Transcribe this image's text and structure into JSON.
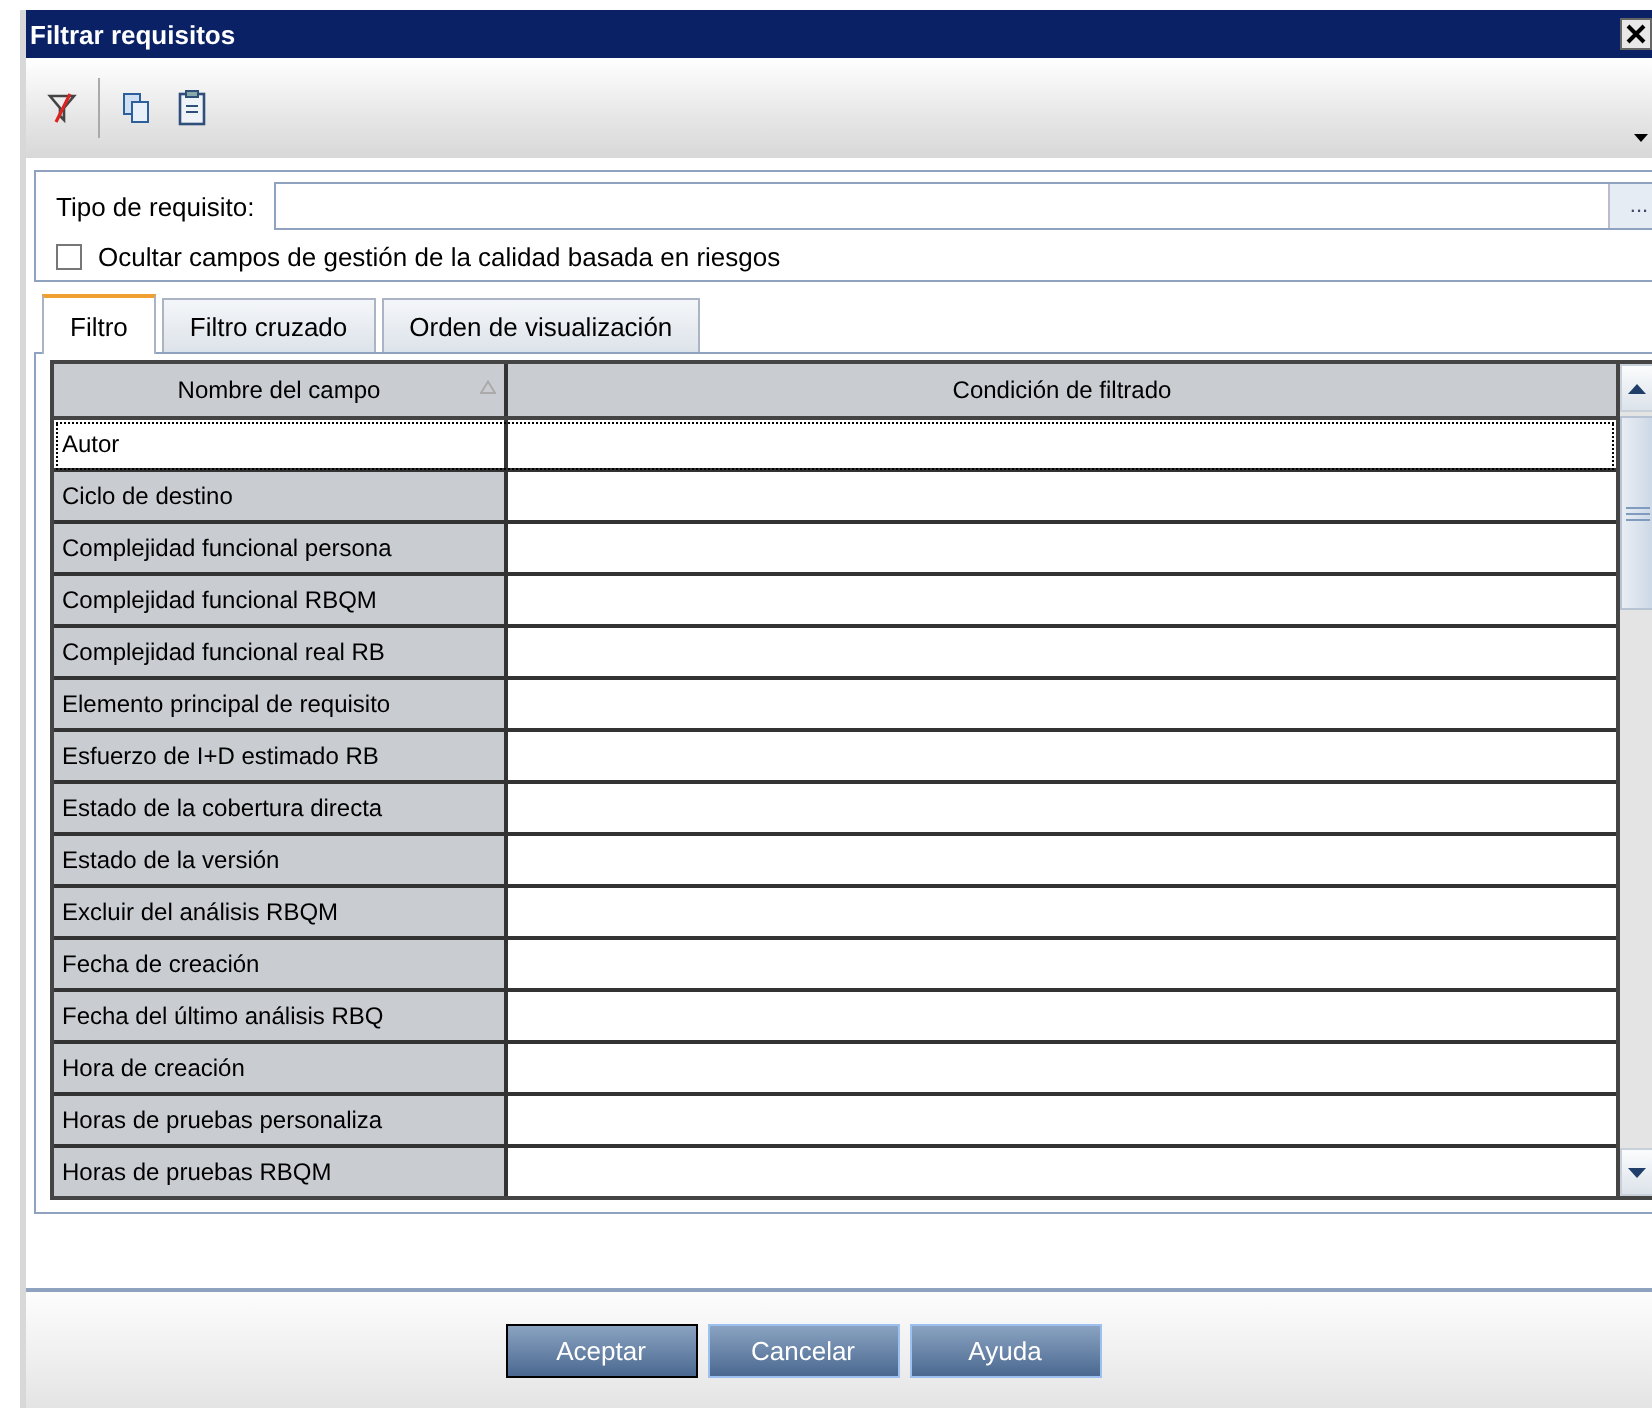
{
  "window": {
    "title": "Filtrar requisitos"
  },
  "toolbar": {
    "has_menu": true
  },
  "type_field": {
    "label": "Tipo de requisito:",
    "browse": "..."
  },
  "hide_option": {
    "label": "Ocultar campos de gestión de la calidad basada en riesgos",
    "checked": false
  },
  "tabs": [
    {
      "label": "Filtro",
      "selected": true
    },
    {
      "label": "Filtro cruzado",
      "selected": false
    },
    {
      "label": "Orden de visualización",
      "selected": false
    }
  ],
  "table": {
    "columns": [
      {
        "label": "Nombre del campo",
        "sorted": true
      },
      {
        "label": "Condición de filtrado",
        "sorted": false
      }
    ],
    "rows": [
      {
        "field": "Autor",
        "selected": true
      },
      {
        "field": "Ciclo de destino",
        "selected": false
      },
      {
        "field": "Complejidad funcional persona",
        "selected": false
      },
      {
        "field": "Complejidad funcional RBQM",
        "selected": false
      },
      {
        "field": "Complejidad funcional real RB",
        "selected": false
      },
      {
        "field": "Elemento principal de requisito",
        "selected": false
      },
      {
        "field": "Esfuerzo de I+D estimado RB",
        "selected": false
      },
      {
        "field": "Estado de la cobertura directa",
        "selected": false
      },
      {
        "field": "Estado de la versión",
        "selected": false
      },
      {
        "field": "Excluir del análisis RBQM",
        "selected": false
      },
      {
        "field": "Fecha de creación",
        "selected": false
      },
      {
        "field": "Fecha del último análisis RBQ",
        "selected": false
      },
      {
        "field": "Hora de creación",
        "selected": false
      },
      {
        "field": "Horas de pruebas personaliza",
        "selected": false
      },
      {
        "field": "Horas de pruebas RBQM",
        "selected": false
      }
    ]
  },
  "buttons": [
    {
      "label": "Aceptar",
      "default": true
    },
    {
      "label": "Cancelar",
      "default": false
    },
    {
      "label": "Ayuda",
      "default": false
    }
  ]
}
